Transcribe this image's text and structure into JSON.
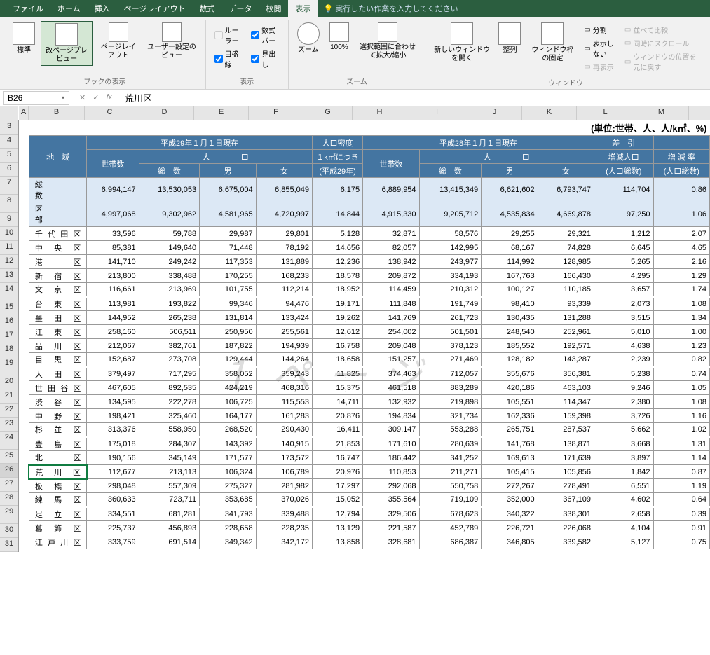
{
  "menubar": {
    "tabs": [
      "ファイル",
      "ホーム",
      "挿入",
      "ページレイアウト",
      "数式",
      "データ",
      "校閲",
      "表示"
    ],
    "active": "表示",
    "tellme": "実行したい作業を入力してください"
  },
  "ribbon": {
    "g1": {
      "label": "ブックの表示",
      "btns": [
        "標準",
        "改ページプレビュー",
        "ページレイアウト",
        "ユーザー設定のビュー"
      ]
    },
    "g2": {
      "label": "表示",
      "chks": [
        "ルーラー",
        "数式バー",
        "目盛線",
        "見出し"
      ]
    },
    "g3": {
      "label": "ズーム",
      "btns": [
        "ズーム",
        "100%",
        "選択範囲に合わせて拡大/縮小"
      ]
    },
    "g4": {
      "label": "ウィンドウ",
      "btns": [
        "新しいウィンドウを開く",
        "整列",
        "ウィンドウ枠の固定"
      ],
      "chks": [
        "分割",
        "表示しない",
        "再表示"
      ],
      "dis": [
        "並べて比較",
        "同時にスクロール",
        "ウィンドウの位置を元に戻す"
      ]
    }
  },
  "formula": {
    "cell": "B26",
    "value": "荒川区"
  },
  "cols": [
    "A",
    "B",
    "C",
    "D",
    "E",
    "F",
    "G",
    "H",
    "I",
    "J",
    "K",
    "L",
    "M"
  ],
  "rows_start": 3,
  "unit_label": "(単位:世帯、人、人/k㎡、%)",
  "headers": {
    "h29": "平成29年１月１日現在",
    "dens": "人口密度",
    "h28": "平成28年１月１日現在",
    "diff1": "差　引",
    "diff2": "増減人口",
    "diff3": "(人口総数)",
    "rate1": "増 減 率",
    "rate3": "(人口総数)",
    "region": "地　域",
    "hh": "世帯数",
    "pop": "人　　　　口",
    "total": "総　数",
    "male": "男",
    "female": "女",
    "per": "１k㎡につき",
    "year": "(平成29年)"
  },
  "totals": {
    "all": {
      "label": "総　　　　数",
      "c": "6,994,147",
      "d": "13,530,053",
      "e": "6,675,004",
      "f": "6,855,049",
      "g": "6,175",
      "h": "6,889,954",
      "i": "13,415,349",
      "j": "6,621,602",
      "k": "6,793,747",
      "l": "114,704",
      "m": "0.86"
    },
    "ku": {
      "label": "区　　　　部",
      "c": "4,997,068",
      "d": "9,302,962",
      "e": "4,581,965",
      "f": "4,720,997",
      "g": "14,844",
      "h": "4,915,330",
      "i": "9,205,712",
      "j": "4,535,834",
      "k": "4,669,878",
      "l": "97,250",
      "m": "1.06"
    }
  },
  "watermark": "１ページ",
  "data": [
    {
      "r": 9,
      "b": "千 代 田 区",
      "c": "33,596",
      "d": "59,788",
      "e": "29,987",
      "f": "29,801",
      "g": "5,128",
      "h": "32,871",
      "i": "58,576",
      "j": "29,255",
      "k": "29,321",
      "l": "1,212",
      "m": "2.07"
    },
    {
      "r": 10,
      "b": "中　央　区",
      "c": "85,381",
      "d": "149,640",
      "e": "71,448",
      "f": "78,192",
      "g": "14,656",
      "h": "82,057",
      "i": "142,995",
      "j": "68,167",
      "k": "74,828",
      "l": "6,645",
      "m": "4.65"
    },
    {
      "r": 11,
      "b": "港　　　区",
      "c": "141,710",
      "d": "249,242",
      "e": "117,353",
      "f": "131,889",
      "g": "12,236",
      "h": "138,942",
      "i": "243,977",
      "j": "114,992",
      "k": "128,985",
      "l": "5,265",
      "m": "2.16"
    },
    {
      "r": 12,
      "b": "新　宿　区",
      "c": "213,800",
      "d": "338,488",
      "e": "170,255",
      "f": "168,233",
      "g": "18,578",
      "h": "209,872",
      "i": "334,193",
      "j": "167,763",
      "k": "166,430",
      "l": "4,295",
      "m": "1.29"
    },
    {
      "r": 13,
      "b": "文　京　区",
      "c": "116,661",
      "d": "213,969",
      "e": "101,755",
      "f": "112,214",
      "g": "18,952",
      "h": "114,459",
      "i": "210,312",
      "j": "100,127",
      "k": "110,185",
      "l": "3,657",
      "m": "1.74"
    },
    {
      "r": 14,
      "b": "台　東　区",
      "c": "113,981",
      "d": "193,822",
      "e": "99,346",
      "f": "94,476",
      "g": "19,171",
      "h": "111,848",
      "i": "191,749",
      "j": "98,410",
      "k": "93,339",
      "l": "2,073",
      "m": "1.08"
    },
    {
      "r": 15,
      "b": "墨　田　区",
      "c": "144,952",
      "d": "265,238",
      "e": "131,814",
      "f": "133,424",
      "g": "19,262",
      "h": "141,769",
      "i": "261,723",
      "j": "130,435",
      "k": "131,288",
      "l": "3,515",
      "m": "1.34"
    },
    {
      "r": 16,
      "b": "江　東　区",
      "c": "258,160",
      "d": "506,511",
      "e": "250,950",
      "f": "255,561",
      "g": "12,612",
      "h": "254,002",
      "i": "501,501",
      "j": "248,540",
      "k": "252,961",
      "l": "5,010",
      "m": "1.00"
    },
    {
      "r": 17,
      "b": "品　川　区",
      "c": "212,067",
      "d": "382,761",
      "e": "187,822",
      "f": "194,939",
      "g": "16,758",
      "h": "209,048",
      "i": "378,123",
      "j": "185,552",
      "k": "192,571",
      "l": "4,638",
      "m": "1.23"
    },
    {
      "r": 18,
      "b": "目　黒　区",
      "c": "152,687",
      "d": "273,708",
      "e": "129,444",
      "f": "144,264",
      "g": "18,658",
      "h": "151,257",
      "i": "271,469",
      "j": "128,182",
      "k": "143,287",
      "l": "2,239",
      "m": "0.82"
    },
    {
      "r": 19,
      "b": "大　田　区",
      "c": "379,497",
      "d": "717,295",
      "e": "358,052",
      "f": "359,243",
      "g": "11,825",
      "h": "374,463",
      "i": "712,057",
      "j": "355,676",
      "k": "356,381",
      "l": "5,238",
      "m": "0.74"
    },
    {
      "r": 20,
      "b": "世 田 谷 区",
      "c": "467,605",
      "d": "892,535",
      "e": "424,219",
      "f": "468,316",
      "g": "15,375",
      "h": "461,518",
      "i": "883,289",
      "j": "420,186",
      "k": "463,103",
      "l": "9,246",
      "m": "1.05"
    },
    {
      "r": 21,
      "b": "渋　谷　区",
      "c": "134,595",
      "d": "222,278",
      "e": "106,725",
      "f": "115,553",
      "g": "14,711",
      "h": "132,932",
      "i": "219,898",
      "j": "105,551",
      "k": "114,347",
      "l": "2,380",
      "m": "1.08"
    },
    {
      "r": 22,
      "b": "中　野　区",
      "c": "198,421",
      "d": "325,460",
      "e": "164,177",
      "f": "161,283",
      "g": "20,876",
      "h": "194,834",
      "i": "321,734",
      "j": "162,336",
      "k": "159,398",
      "l": "3,726",
      "m": "1.16"
    },
    {
      "r": 23,
      "b": "杉　並　区",
      "c": "313,376",
      "d": "558,950",
      "e": "268,520",
      "f": "290,430",
      "g": "16,411",
      "h": "309,147",
      "i": "553,288",
      "j": "265,751",
      "k": "287,537",
      "l": "5,662",
      "m": "1.02"
    },
    {
      "r": 24,
      "b": "豊　島　区",
      "c": "175,018",
      "d": "284,307",
      "e": "143,392",
      "f": "140,915",
      "g": "21,853",
      "h": "171,610",
      "i": "280,639",
      "j": "141,768",
      "k": "138,871",
      "l": "3,668",
      "m": "1.31"
    },
    {
      "r": 25,
      "b": "北　　　区",
      "c": "190,156",
      "d": "345,149",
      "e": "171,577",
      "f": "173,572",
      "g": "16,747",
      "h": "186,442",
      "i": "341,252",
      "j": "169,613",
      "k": "171,639",
      "l": "3,897",
      "m": "1.14"
    },
    {
      "r": 26,
      "b": "荒　川　区",
      "c": "112,677",
      "d": "213,113",
      "e": "106,324",
      "f": "106,789",
      "g": "20,976",
      "h": "110,853",
      "i": "211,271",
      "j": "105,415",
      "k": "105,856",
      "l": "1,842",
      "m": "0.87"
    },
    {
      "r": 27,
      "b": "板　橋　区",
      "c": "298,048",
      "d": "557,309",
      "e": "275,327",
      "f": "281,982",
      "g": "17,297",
      "h": "292,068",
      "i": "550,758",
      "j": "272,267",
      "k": "278,491",
      "l": "6,551",
      "m": "1.19"
    },
    {
      "r": 28,
      "b": "練　馬　区",
      "c": "360,633",
      "d": "723,711",
      "e": "353,685",
      "f": "370,026",
      "g": "15,052",
      "h": "355,564",
      "i": "719,109",
      "j": "352,000",
      "k": "367,109",
      "l": "4,602",
      "m": "0.64"
    },
    {
      "r": 29,
      "b": "足　立　区",
      "c": "334,551",
      "d": "681,281",
      "e": "341,793",
      "f": "339,488",
      "g": "12,794",
      "h": "329,506",
      "i": "678,623",
      "j": "340,322",
      "k": "338,301",
      "l": "2,658",
      "m": "0.39"
    },
    {
      "r": 30,
      "b": "葛　飾　区",
      "c": "225,737",
      "d": "456,893",
      "e": "228,658",
      "f": "228,235",
      "g": "13,129",
      "h": "221,587",
      "i": "452,789",
      "j": "226,721",
      "k": "226,068",
      "l": "4,104",
      "m": "0.91"
    },
    {
      "r": 31,
      "b": "江 戸 川 区",
      "c": "333,759",
      "d": "691,514",
      "e": "349,342",
      "f": "342,172",
      "g": "13,858",
      "h": "328,681",
      "i": "686,387",
      "j": "346,805",
      "k": "339,582",
      "l": "5,127",
      "m": "0.75"
    }
  ]
}
